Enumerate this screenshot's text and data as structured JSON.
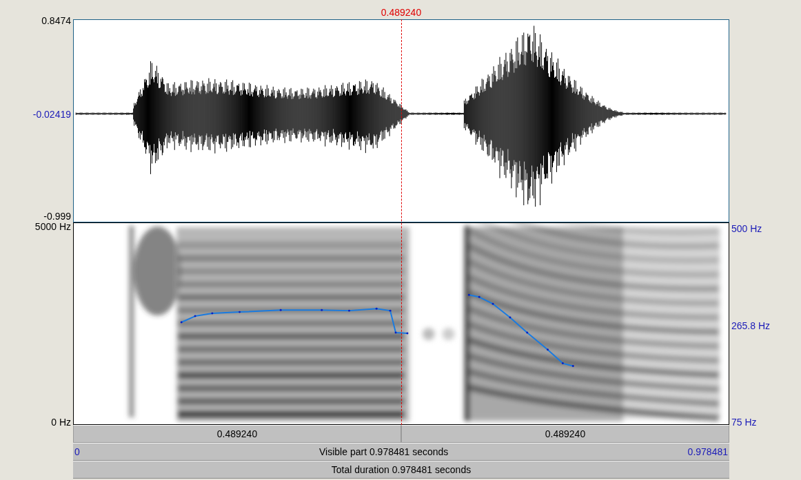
{
  "cursor": {
    "time": "0.489240"
  },
  "waveform": {
    "y_max": "0.8474",
    "y_cursor": "-0.02419",
    "y_min": "-0.999"
  },
  "spectrogram": {
    "freq_max": "5000 Hz",
    "freq_min": "0 Hz",
    "pitch_max": "500 Hz",
    "pitch_mid": "265.8 Hz",
    "pitch_min": "75 Hz"
  },
  "time_bars": {
    "segments": [
      {
        "label": "0.489240"
      },
      {
        "label": "0.489240"
      }
    ],
    "visible": {
      "start": "0",
      "label": "Visible part 0.978481 seconds",
      "end": "0.978481"
    },
    "total": {
      "label": "Total duration 0.978481 seconds"
    }
  }
}
